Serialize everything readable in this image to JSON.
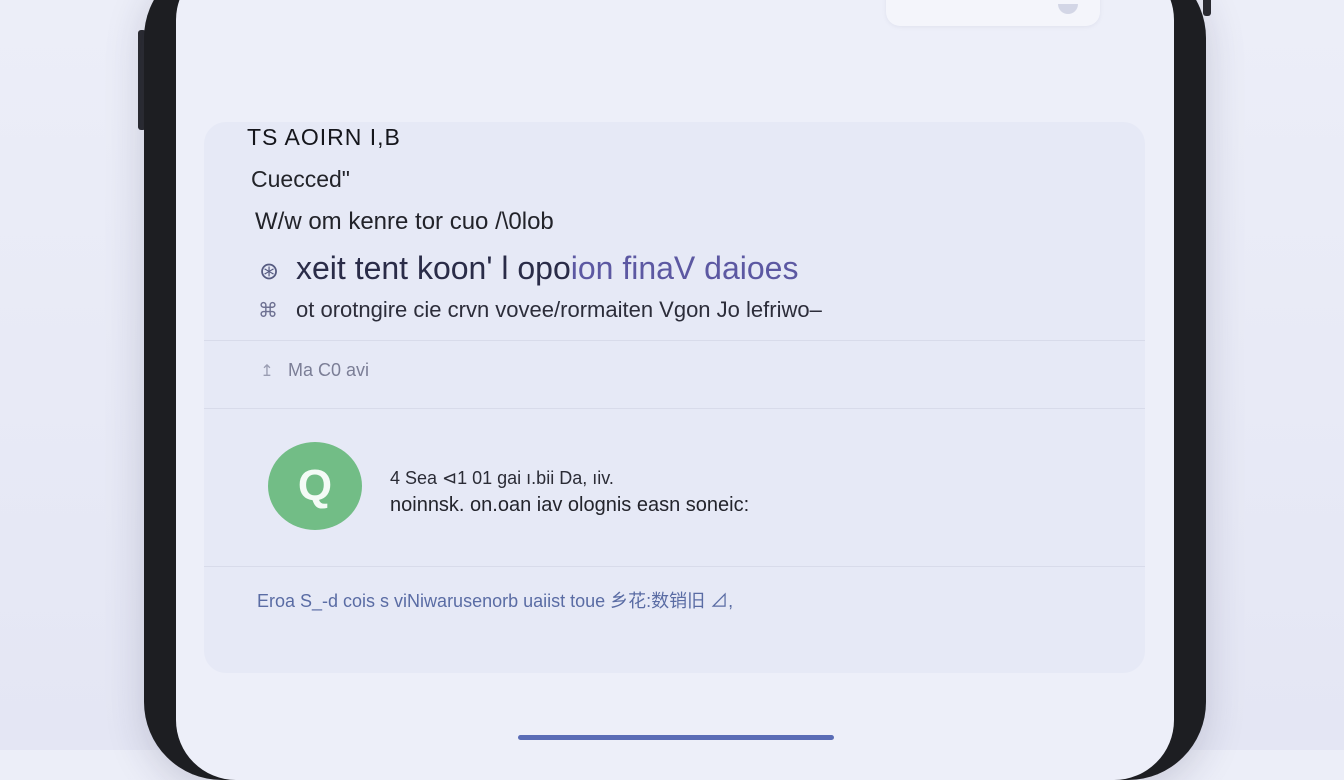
{
  "header": {
    "top_text": "— · — · · ·"
  },
  "card": {
    "title": "TS AOIRN I,B",
    "subtitle": "Cuecced\"",
    "line3": "W/w om kenre tor cuo /\\0lob",
    "headline_prefix": "xeit tent koon' l opo",
    "headline_highlight": "ion finaV daioes",
    "headline_glyph": "⊛",
    "detail_glyph": "⌘",
    "detail": "ot orotngire cie crvn vovee/rormaiten Vgon  Jo lefriwo–",
    "meta_glyph": "↥",
    "meta": "Ma C0 avi"
  },
  "message": {
    "avatar_letter": "Q",
    "line1": "4 Sea ⊲1 01 gai  ı.bii  Da, ıiv.",
    "line2": "noinnsk. on.oan iav olognis  easn soneic:"
  },
  "footer": {
    "text": "Eroa S_-d cois s viNiwarusenorb uaiist toue 乡花:数销旧 ⊿,"
  },
  "colors": {
    "background": "#e9ebf6",
    "phone_frame": "#1d1e22",
    "card": "#e6e9f6",
    "accent": "#5c58a2",
    "avatar": "#72bd86",
    "link": "#5a6ca4"
  }
}
